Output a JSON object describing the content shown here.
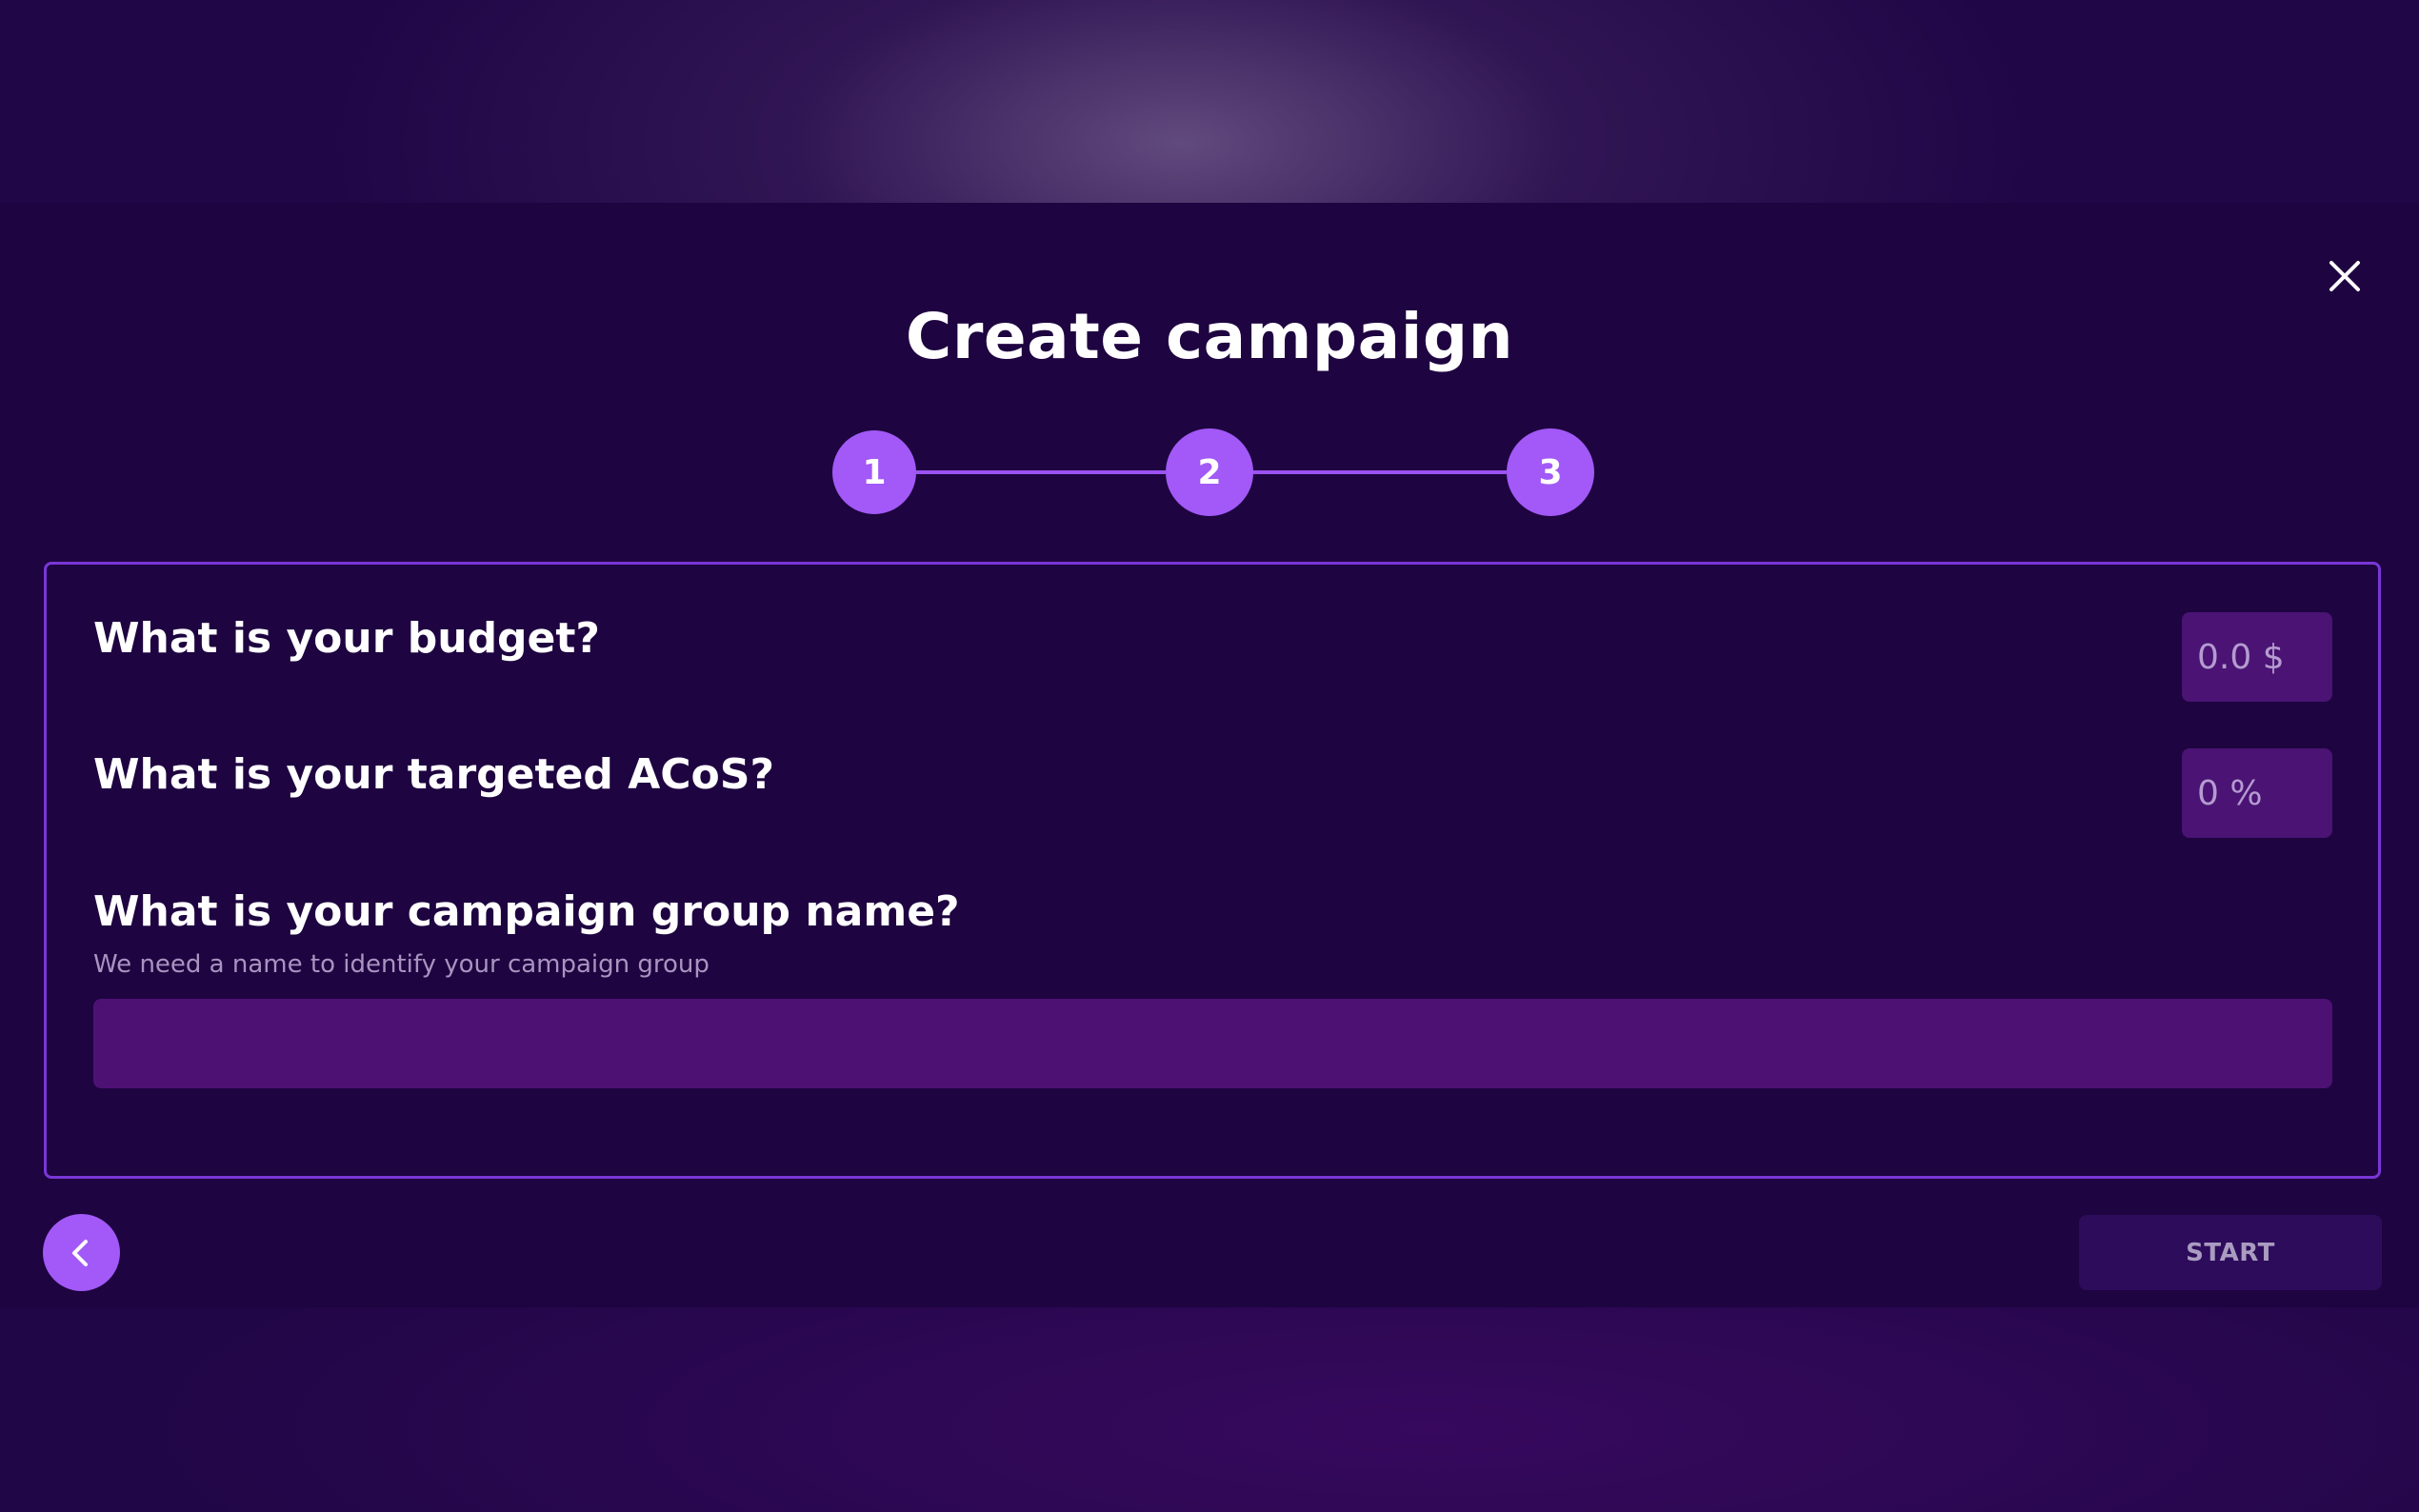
{
  "modal": {
    "title": "Create campaign",
    "close_icon": "close-icon",
    "steps": [
      "1",
      "2",
      "3"
    ],
    "colors": {
      "accent": "#a259f7",
      "modal_bg": "#1e0440",
      "input_bg": "#4d1174",
      "border": "#7a36d6"
    }
  },
  "form": {
    "budget": {
      "label": "What is your budget?",
      "placeholder": "0.0 $"
    },
    "acos": {
      "label": "What is your targeted ACoS?",
      "placeholder": "0 %"
    },
    "group_name": {
      "label": "What is your campaign group name?",
      "helper": "We need a name to identify your campaign group",
      "value": ""
    }
  },
  "footer": {
    "back_icon": "chevron-left-icon",
    "start_label": "START"
  }
}
